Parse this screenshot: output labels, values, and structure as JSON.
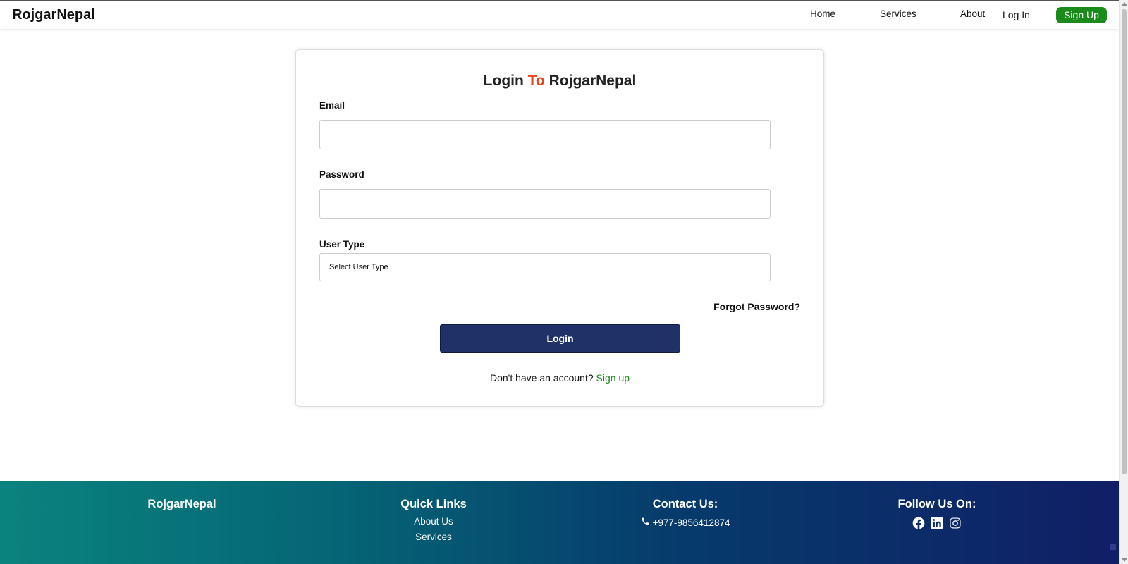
{
  "header": {
    "brand": "RojgarNepal",
    "nav": {
      "home": "Home",
      "services": "Services",
      "about": "About",
      "login": "Log In",
      "signup": "Sign Up"
    }
  },
  "login_form": {
    "title_part1": "Login",
    "title_accent": "To",
    "title_part2": "RojgarNepal",
    "email_label": "Email",
    "email_value": "",
    "password_label": "Password",
    "password_value": "",
    "user_type_label": "User Type",
    "user_type_selected": "Select User Type",
    "forgot_password": "Forgot Password?",
    "login_button": "Login",
    "no_account_text": "Don't have an account?",
    "signup_link": "Sign up"
  },
  "footer": {
    "brand": "RojgarNepal",
    "quick_links_heading": "Quick Links",
    "quick_links": [
      "About Us",
      "Services"
    ],
    "contact_heading": "Contact Us:",
    "phone": "+977-9856412874",
    "follow_heading": "Follow Us On:",
    "social_icons": [
      "facebook-icon",
      "linkedin-icon",
      "instagram-icon"
    ]
  },
  "colors": {
    "accent_orange": "#e8441a",
    "signup_green": "#1a8a1a",
    "login_button_navy": "#1f3166",
    "footer_gradient_start": "#0a837e",
    "footer_gradient_end": "#101f66"
  }
}
